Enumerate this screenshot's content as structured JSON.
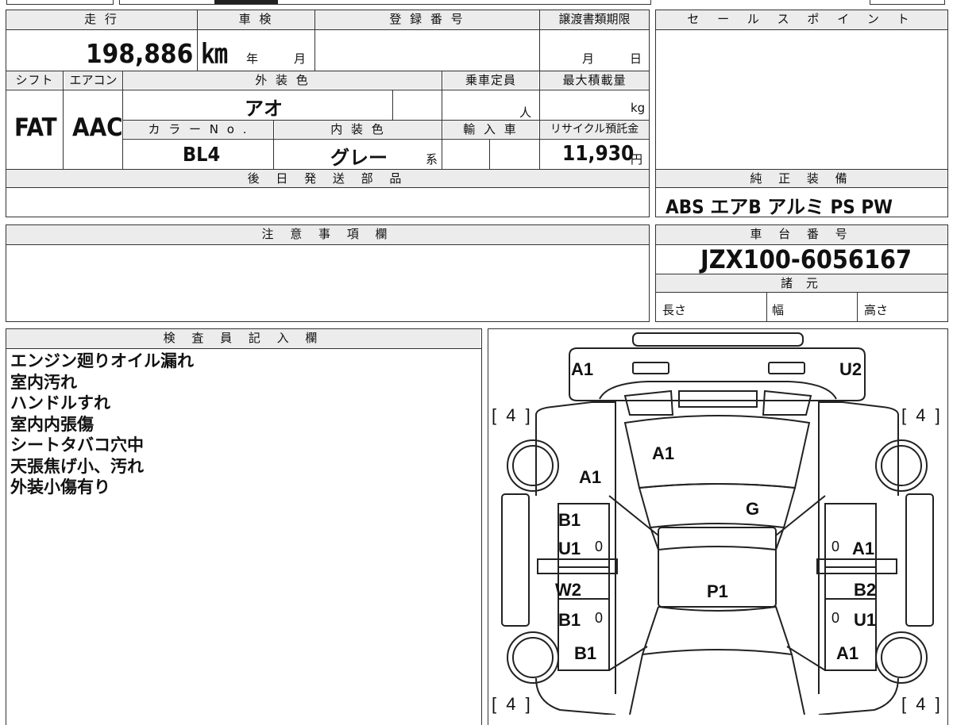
{
  "vehicle": {
    "mileage_label": "走 行",
    "mileage": "198,886 ㎞",
    "shaken_label": "車 検",
    "shaken_year": "年",
    "shaken_month": "月",
    "registration_label": "登 録 番 号",
    "transfer_label": "譲渡書類期限",
    "transfer_month": "月",
    "transfer_day": "日",
    "shift_label": "シフト",
    "shift": "FAT",
    "aircon_label": "エアコン",
    "aircon": "AAC",
    "exterior_label": "外 装 色",
    "exterior": "アオ",
    "capacity_label": "乗車定員",
    "capacity_unit": "人",
    "maxload_label": "最大積載量",
    "maxload_unit": "kg",
    "color_no_label": "カ ラ ー N o .",
    "color_no": "BL4",
    "interior_label": "内 装 色",
    "interior": "グレー",
    "interior_suffix": "系",
    "import_label": "輸 入 車",
    "recycle_label": "リサイクル預託金",
    "recycle": "11,930",
    "recycle_unit": "円",
    "parts_label": "後 日 発 送 部 品"
  },
  "sales_point_label": "セ ー ル ス ポ イ ン ト",
  "equipment_label": "純 正 装 備",
  "equipment": "ABS エアB アルミ PS PW",
  "notes_label": "注 意 事 項 欄",
  "chassis_label": "車 台 番 号",
  "chassis": "JZX100-6056167",
  "specs_label": "諸 元",
  "length_label": "長さ",
  "width_label": "幅",
  "height_label": "高さ",
  "inspector_label": "検 査 員 記 入 欄",
  "inspector_notes": [
    "エンジン廻りオイル漏れ",
    "室内汚れ",
    "ハンドルすれ",
    "室内内張傷",
    "シートタバコ穴中",
    "天張焦げ小、汚れ",
    "外装小傷有り"
  ],
  "diagram": {
    "tires": [
      "[ 4 ]",
      "[ 4 ]",
      "[ 4 ]",
      "[ 4 ]"
    ],
    "marks": {
      "rear_left": "A1",
      "rear_right": "U2",
      "rear_glass": "A1",
      "left_rear_fender": "A1",
      "roof": "G",
      "left_rear_door_1": "B1",
      "left_rear_door_2": "U1",
      "right_rear_door": "A1",
      "left_front_door_1": "W2",
      "left_front_door_2": "B1",
      "right_front_door_1": "B2",
      "right_front_door_2": "U1",
      "roof_center": "P1",
      "left_front_fender": "B1",
      "right_front_fender": "A1",
      "zero_1": "0",
      "zero_2": "0",
      "zero_3": "0",
      "zero_4": "0"
    }
  }
}
